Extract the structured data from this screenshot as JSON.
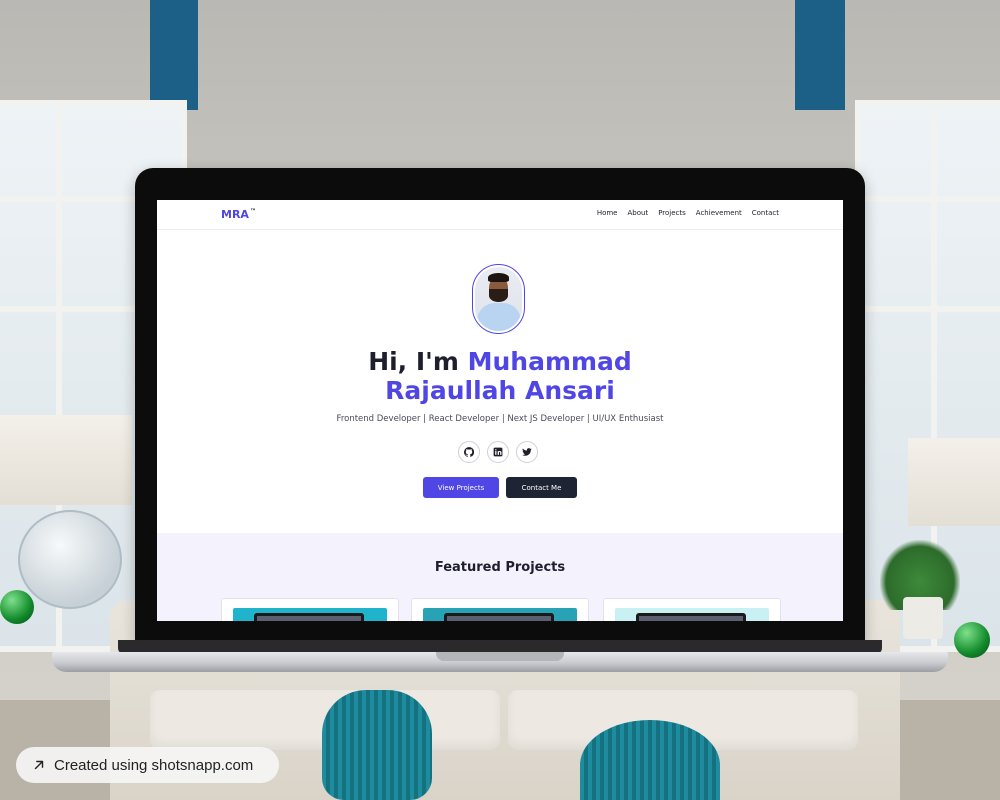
{
  "site": {
    "logo": "MRA",
    "logo_mark": "™",
    "nav": [
      "Home",
      "About",
      "Projects",
      "Achievement",
      "Contact"
    ],
    "hero": {
      "greeting": "Hi, I'm ",
      "name_line1": "Muhammad",
      "name_line2": "Rajaullah Ansari",
      "subtitle": "Frontend Developer | React Developer | Next JS Developer | UI/UX Enthusiast",
      "socials": [
        "github-icon",
        "linkedin-icon",
        "twitter-icon"
      ],
      "primary_button": "View Projects",
      "secondary_button": "Contact Me"
    },
    "featured": {
      "title": "Featured Projects"
    },
    "colors": {
      "accent": "#4f46e5",
      "dark": "#1e2433",
      "featured_bg": "#f4f2fd"
    }
  },
  "badge": {
    "text": "Created using shotsnapp.com",
    "icon": "arrow-up-right-icon"
  }
}
